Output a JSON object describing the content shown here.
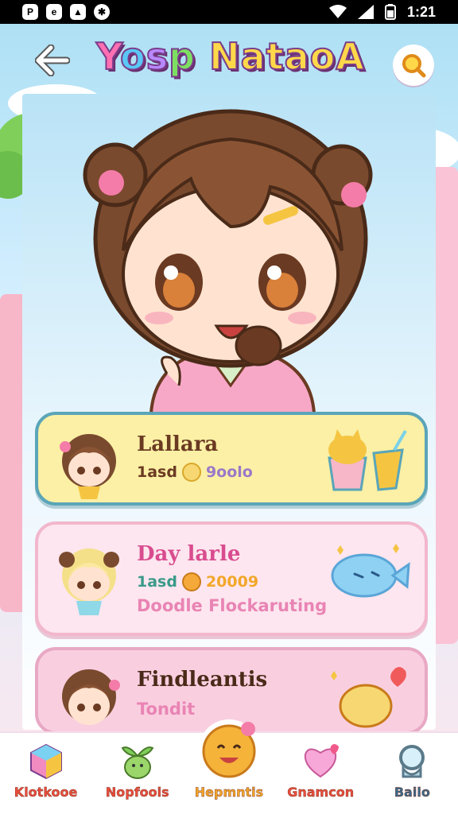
{
  "status_bar": {
    "time": "1:21"
  },
  "header": {
    "title": [
      "Y",
      "o",
      "s",
      "p",
      " ",
      "N",
      "a",
      "t",
      "a",
      "o",
      "A"
    ]
  },
  "cards": [
    {
      "name": "Lallara",
      "stat_prefix": "1asd",
      "stat_value": "9oolo",
      "subtitle": ""
    },
    {
      "name": "Day larle",
      "stat_prefix": "1asd",
      "stat_value": "20009",
      "subtitle": "Doodle Flockaruting"
    },
    {
      "name": "Findleantis",
      "stat_prefix": "",
      "stat_value": "",
      "subtitle": "Tondit"
    }
  ],
  "nav": [
    {
      "label": "Klotkooe"
    },
    {
      "label": "Nopfoois"
    },
    {
      "label": "Hepmntis"
    },
    {
      "label": "Gnamcon"
    },
    {
      "label": "Bailo"
    }
  ],
  "colors": {
    "accent": "#f2a72a",
    "card1": "#fbf0a5",
    "card2": "#fde6ef",
    "card3": "#f9cfe0"
  }
}
